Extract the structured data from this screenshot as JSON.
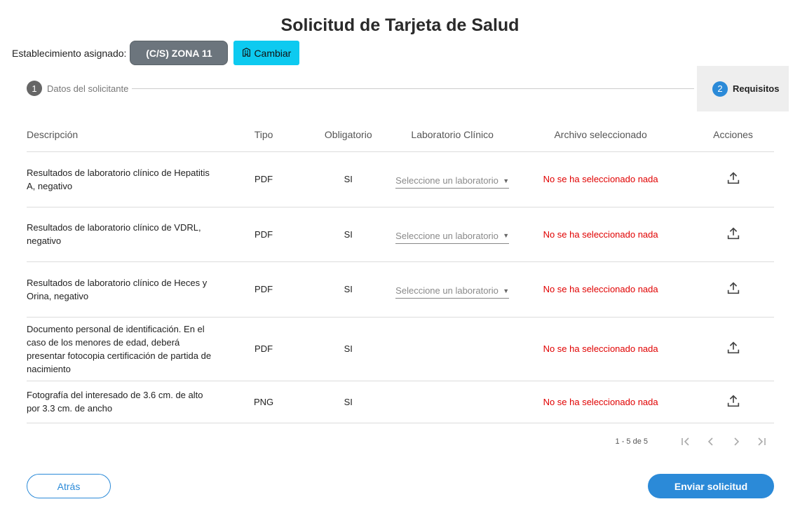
{
  "page": {
    "title": "Solicitud de Tarjeta de Salud"
  },
  "establishment": {
    "label": "Establecimiento asignado:",
    "zone": "(C/S) ZONA 11",
    "change_label": "Cambiar"
  },
  "stepper": {
    "steps": [
      {
        "number": "1",
        "label": "Datos del solicitante",
        "active": false
      },
      {
        "number": "2",
        "label": "Requisitos",
        "active": true
      }
    ]
  },
  "table": {
    "headers": {
      "description": "Descripción",
      "type": "Tipo",
      "required": "Obligatorio",
      "lab": "Laboratorio Clínico",
      "file": "Archivo seleccionado",
      "actions": "Acciones"
    },
    "rows": [
      {
        "description": "Resultados de laboratorio clínico de Hepatitis A, negativo",
        "type": "PDF",
        "required": "SI",
        "lab_placeholder": "Seleccione un laboratorio",
        "file": "No se ha seleccionado nada"
      },
      {
        "description": "Resultados de laboratorio clínico de VDRL, negativo",
        "type": "PDF",
        "required": "SI",
        "lab_placeholder": "Seleccione un laboratorio",
        "file": "No se ha seleccionado nada"
      },
      {
        "description": "Resultados de laboratorio clínico de Heces y Orina, negativo",
        "type": "PDF",
        "required": "SI",
        "lab_placeholder": "Seleccione un laboratorio",
        "file": "No se ha seleccionado nada"
      },
      {
        "description": "Documento personal de identificación. En el caso de los menores de edad, deberá presentar fotocopia certificación de partida de nacimiento",
        "type": "PDF",
        "required": "SI",
        "lab_placeholder": "",
        "file": "No se ha seleccionado nada"
      },
      {
        "description": "Fotografía del interesado de 3.6 cm. de alto por 3.3 cm. de ancho",
        "type": "PNG",
        "required": "SI",
        "lab_placeholder": "",
        "file": "No se ha seleccionado nada"
      }
    ]
  },
  "pagination": {
    "range": "1 - 5 de 5"
  },
  "footer": {
    "back_label": "Atrás",
    "submit_label": "Enviar solicitud"
  },
  "icons": {
    "building": "building-icon",
    "upload": "upload-icon",
    "first_page": "first-page-icon",
    "prev_page": "chevron-left-icon",
    "next_page": "chevron-right-icon",
    "last_page": "last-page-icon"
  },
  "colors": {
    "primary": "#2b8ad8",
    "info": "#0dcaf0",
    "chip": "#6c757d",
    "error": "#e00000"
  }
}
